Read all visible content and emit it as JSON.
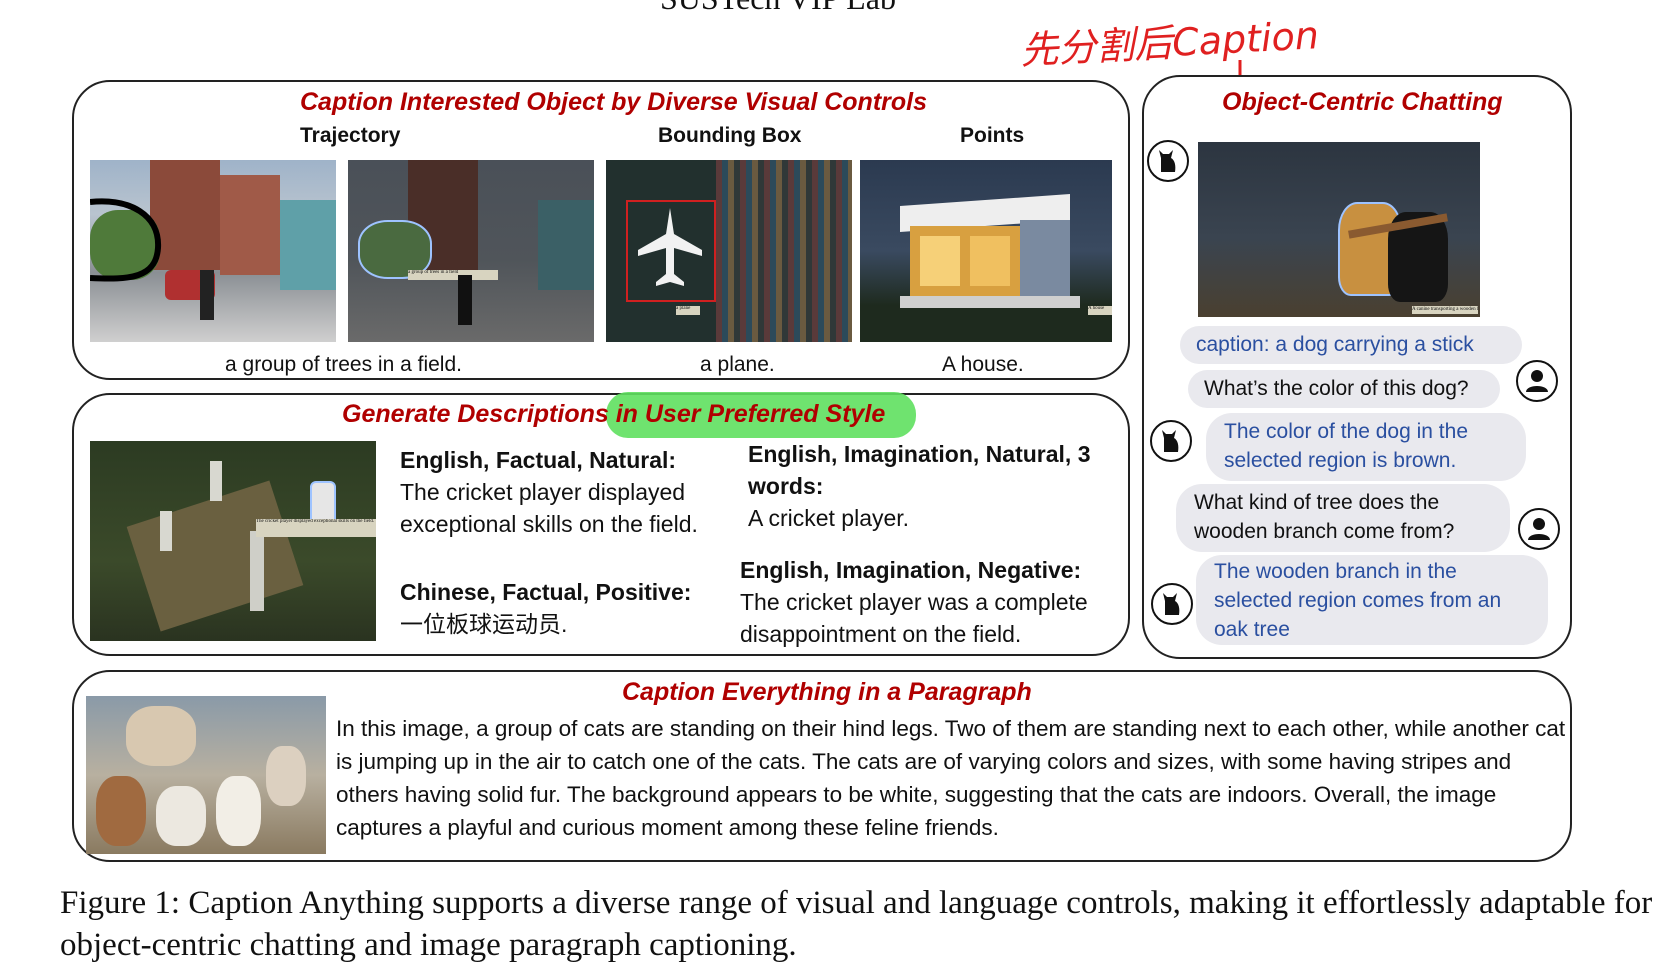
{
  "header_fragment": "SUSTech VIP Lab",
  "handwritten_note": "先分割后Caption",
  "panel_visual_controls": {
    "title": "Caption Interested Object by Diverse Visual Controls",
    "columns": [
      "Trajectory",
      "Bounding Box",
      "Points"
    ],
    "captions": [
      "a group of trees in a field.",
      "a plane.",
      "A house."
    ],
    "image_labels": [
      "a group of trees in a field",
      "a plane",
      "A house"
    ]
  },
  "panel_style": {
    "title": "Generate Descriptions in User Preferred Style",
    "image_label": "The cricket player displayed exceptional skills on the field.",
    "items": [
      {
        "heading": "English, Factual, Natural:",
        "text": "The cricket player displayed exceptional skills on the field."
      },
      {
        "heading": "English, Imagination, Natural, 3 words:",
        "text": "A cricket player."
      },
      {
        "heading": "Chinese, Factual, Positive:",
        "text": "一位板球运动员."
      },
      {
        "heading": "English, Imagination, Negative:",
        "text": "The cricket player was a complete disappointment on the field."
      }
    ]
  },
  "panel_chat": {
    "title": "Object-Centric Chatting",
    "image_label": "A canine transporting a wooden branch",
    "messages": [
      {
        "role": "bot",
        "text": "caption: a dog carrying a stick"
      },
      {
        "role": "user",
        "text": "What’s the color of this dog?"
      },
      {
        "role": "bot",
        "text": "The color of the dog in the selected region is brown."
      },
      {
        "role": "user",
        "text": "What kind of tree does the wooden branch come from?"
      },
      {
        "role": "bot",
        "text": "The wooden branch in the selected region comes from an oak tree"
      }
    ]
  },
  "panel_paragraph": {
    "title": "Caption Everything in a Paragraph",
    "text": "In this image, a group of cats are standing on their hind legs. Two of them are standing next to each other, while another cat is jumping up in the air to catch one of the cats. The cats are of varying colors and sizes, with some having stripes and others having solid fur. The background appears to be white, suggesting that the cats are indoors. Overall, the image captures a playful and curious moment among these feline friends."
  },
  "figure_caption": "Figure 1: Caption Anything supports a diverse range of visual and language controls, making it effortlessly adaptable for object-centric chatting and image paragraph captioning.",
  "colors": {
    "title_red": "#b00000",
    "bot_blue": "#2a4fa0",
    "highlight_green": "#5fe05f",
    "annotation_red": "#e02020"
  }
}
